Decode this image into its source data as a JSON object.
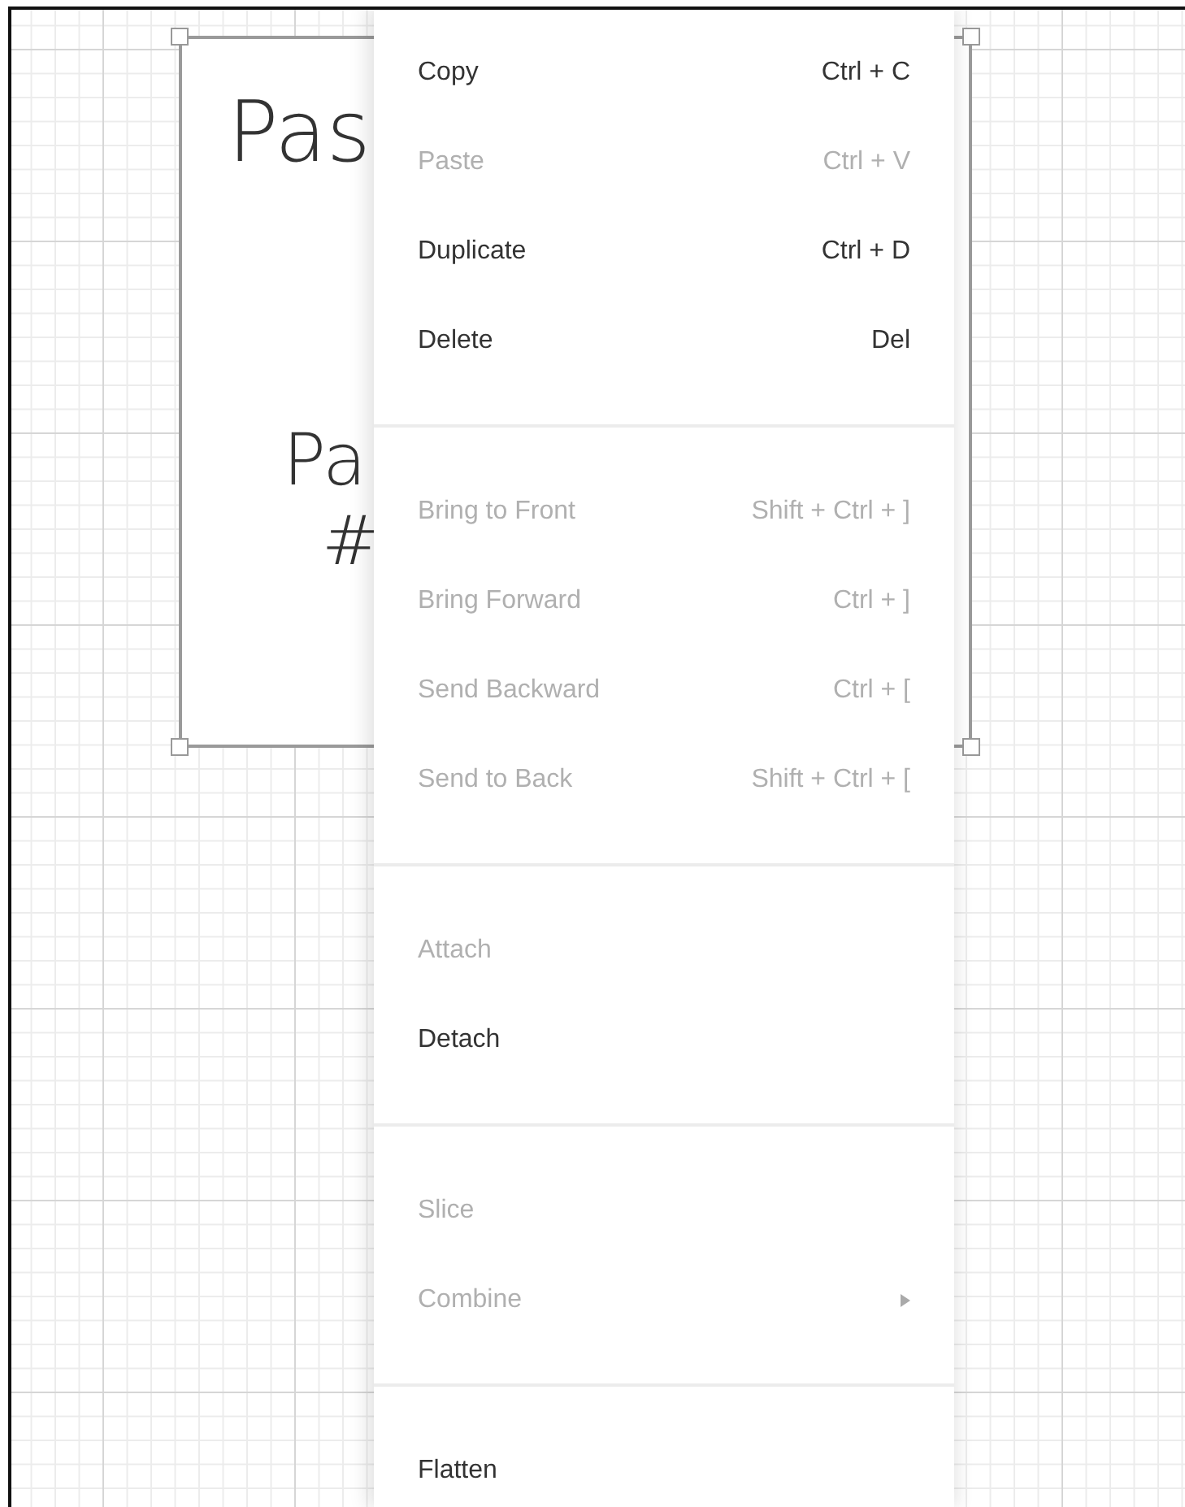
{
  "canvas": {
    "card": {
      "texts": [
        "Pas",
        "Pa",
        "#"
      ],
      "selected": true
    }
  },
  "context_menu": {
    "groups": [
      {
        "items": [
          {
            "label": "Copy",
            "shortcut": "Ctrl + C",
            "disabled": false,
            "submenu": false
          },
          {
            "label": "Paste",
            "shortcut": "Ctrl + V",
            "disabled": true,
            "submenu": false
          },
          {
            "label": "Duplicate",
            "shortcut": "Ctrl + D",
            "disabled": false,
            "submenu": false
          },
          {
            "label": "Delete",
            "shortcut": "Del",
            "disabled": false,
            "submenu": false
          }
        ]
      },
      {
        "items": [
          {
            "label": "Bring to Front",
            "shortcut": "Shift + Ctrl + ]",
            "disabled": true,
            "submenu": false
          },
          {
            "label": "Bring Forward",
            "shortcut": "Ctrl + ]",
            "disabled": true,
            "submenu": false
          },
          {
            "label": "Send Backward",
            "shortcut": "Ctrl + [",
            "disabled": true,
            "submenu": false
          },
          {
            "label": "Send to Back",
            "shortcut": "Shift + Ctrl + [",
            "disabled": true,
            "submenu": false
          }
        ]
      },
      {
        "items": [
          {
            "label": "Attach",
            "disabled": true,
            "submenu": false
          },
          {
            "label": "Detach",
            "disabled": false,
            "submenu": false
          }
        ]
      },
      {
        "items": [
          {
            "label": "Slice",
            "disabled": true,
            "submenu": false
          },
          {
            "label": "Combine",
            "disabled": true,
            "submenu": true
          }
        ]
      },
      {
        "items": [
          {
            "label": "Flatten",
            "disabled": false,
            "submenu": false
          }
        ]
      }
    ]
  }
}
